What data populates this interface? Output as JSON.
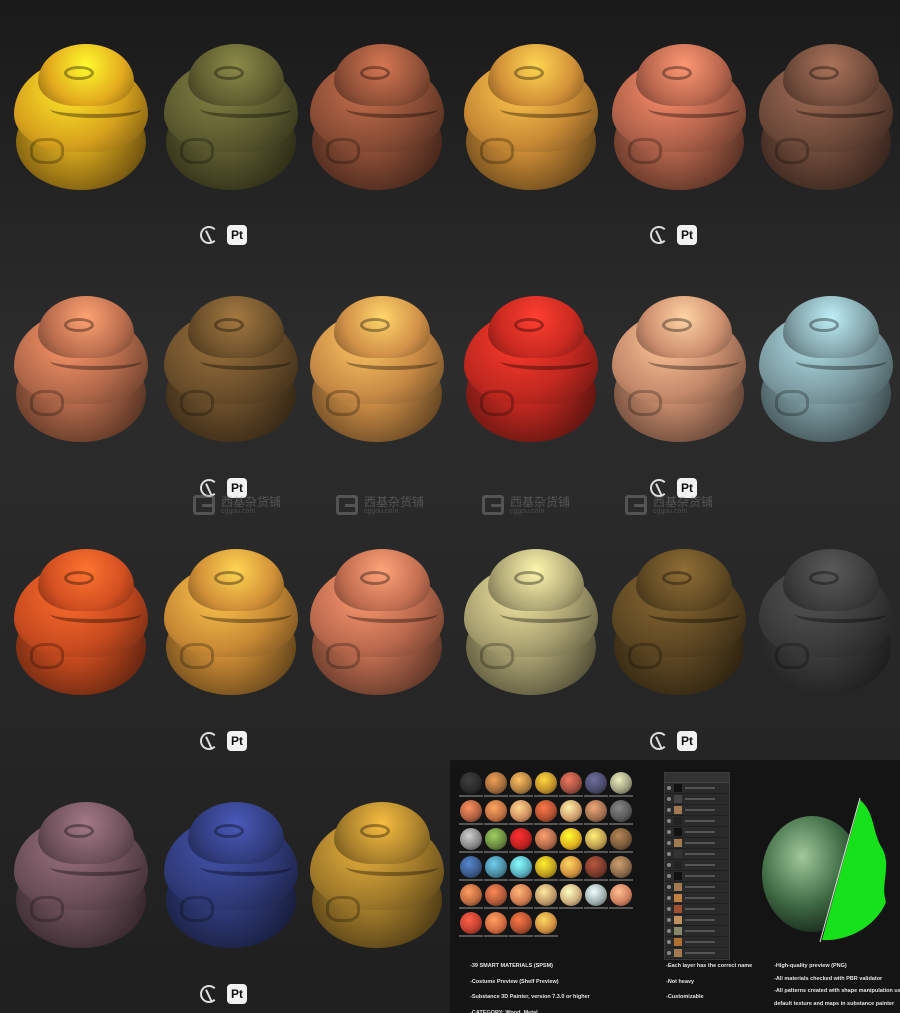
{
  "logos": {
    "painter_badge": "Pt"
  },
  "watermark": {
    "text": "西基杂货铺",
    "sub": "cggou.com"
  },
  "palettes": [
    [
      "#d8a21d",
      "#5b5a2f",
      "#8a4d35",
      "#c98a35",
      "#b0624a",
      "#6e4a3a"
    ],
    [
      "#b2694a",
      "#6a4e2a",
      "#c88a45",
      "#c0281f",
      "#c4896a",
      "#7b9aa0"
    ],
    [
      "#c84b1f",
      "#c98a35",
      "#bb6a4e",
      "#a8a070",
      "#5d4722",
      "#3a3a3a"
    ],
    [
      "#6a4e58",
      "#2f3a78",
      "#a07a2a"
    ]
  ],
  "preview": {
    "thumb_colors": [
      "#2a2a2a",
      "#a06a3a",
      "#b08040",
      "#c0902a",
      "#a05040",
      "#4a4a6a",
      "#a0a080",
      "#b06040",
      "#c07040",
      "#d09060",
      "#b05030",
      "#d0a070",
      "#a07050",
      "#5a5a5a",
      "#8a8a8a",
      "#6a8a40",
      "#c02020",
      "#b06a4a",
      "#e0b020",
      "#c0a050",
      "#7a5a3a",
      "#3a5a8a",
      "#4a8aa0",
      "#5ab0c0",
      "#c0a020",
      "#d09040",
      "#7a3a2a",
      "#8a6a4a",
      "#c06a40",
      "#b05a3a",
      "#d07a50",
      "#c09a6a",
      "#d0b080",
      "#a0b0b0",
      "#d08060",
      "#c04030",
      "#d06a40",
      "#b05030",
      "#d09040"
    ],
    "layer_swatches": [
      "#111",
      "#444",
      "#a07a50",
      "#222",
      "#111",
      "#a07a50",
      "#333",
      "#222",
      "#111",
      "#a07a50",
      "#c08040",
      "#a05030",
      "#c09060",
      "#886",
      "#b07030",
      "#a07a50"
    ],
    "col1": [
      "-39 SMART MATERIALS (SPSM)",
      "-Costume Preview (Shelf Preview)",
      "-Substance 3D Painter, version 7.3.0 or higher",
      "-CATEGORY: Wood, Metal"
    ],
    "col2": [
      "-Each layer has the correct name",
      "-Not heavy",
      "-Customizable"
    ],
    "col3": [
      "-High-quality preview (PNG)",
      "-All materials checked with PBR validator",
      "-All patterns created with shape manipulation using",
      "default texture and maps in substance painter"
    ]
  }
}
